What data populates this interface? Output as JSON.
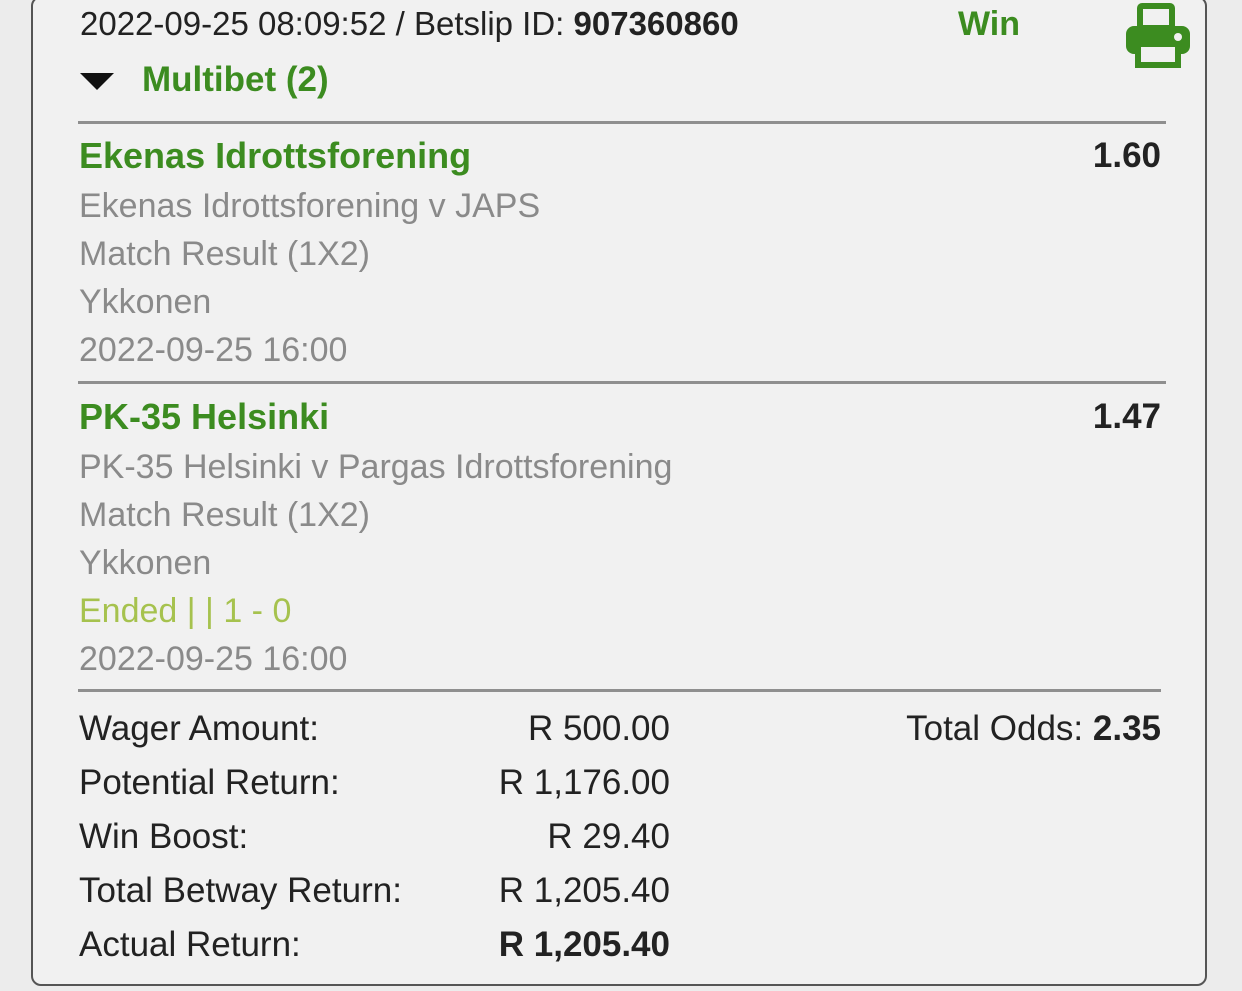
{
  "header": {
    "datetime": "2022-09-25 08:09:52",
    "separator": " / ",
    "betslip_label": "Betslip ID: ",
    "betslip_id": "907360860",
    "status": "Win",
    "print_icon": "printer-icon"
  },
  "bet_type": {
    "label": "Multibet (2)",
    "toggle_icon": "caret-down-icon"
  },
  "selections": [
    {
      "name": "Ekenas Idrottsforening",
      "odds": "1.60",
      "event": "Ekenas Idrottsforening v JAPS",
      "market": "Match Result (1X2)",
      "league": "Ykkonen",
      "status": "",
      "start_time": "2022-09-25 16:00"
    },
    {
      "name": "PK-35 Helsinki",
      "odds": "1.47",
      "event": "PK-35 Helsinki v Pargas Idrottsforening",
      "market": "Match Result (1X2)",
      "league": "Ykkonen",
      "status": "Ended | | 1 - 0",
      "start_time": "2022-09-25 16:00"
    }
  ],
  "summary": {
    "wager_label": "Wager Amount:",
    "wager_value": "R 500.00",
    "potential_label": "Potential Return:",
    "potential_value": "R 1,176.00",
    "boost_label": "Win Boost:",
    "boost_value": "R 29.40",
    "betway_label": "Total Betway Return:",
    "betway_value": "R 1,205.40",
    "actual_label": "Actual Return:",
    "actual_value": "R 1,205.40",
    "total_odds_label": "Total Odds: ",
    "total_odds_value": "2.35"
  },
  "colors": {
    "accent_green": "#3c8c20",
    "muted_text": "#8a8a8a",
    "status_lime": "#a6c24e"
  }
}
